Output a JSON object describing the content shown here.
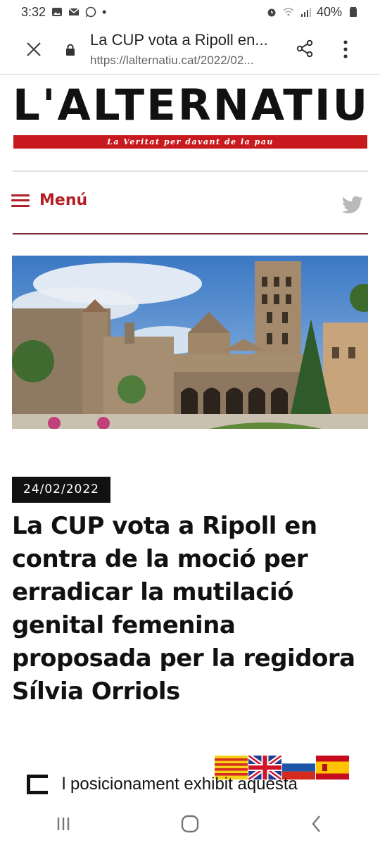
{
  "status": {
    "time": "3:32",
    "battery": "40%",
    "dot": "•"
  },
  "browser": {
    "title": "La CUP vota a Ripoll en...",
    "url": "https://lalternatiu.cat/2022/02..."
  },
  "site": {
    "brand": "L'ALTERNATIU",
    "tagline": "La Veritat per davant de la pau",
    "menu_label": "Menú"
  },
  "article": {
    "date": "24/02/2022",
    "headline": "La CUP vota a Ripoll en contra de la moció per erradicar la mutilació genital femenina proposada per la regidora Sílvia Orriols",
    "snippet": "l posicionament exhibit aquesta"
  },
  "colors": {
    "brand_red": "#c8191e",
    "menu_red": "#b41e24",
    "twitter_grey": "#b9b9b9"
  },
  "icons": {
    "close": "close-icon",
    "lock": "lock-icon",
    "share": "share-icon",
    "more": "more-vert-icon",
    "menu": "hamburger-icon",
    "twitter": "twitter-icon"
  },
  "flags": [
    "catalan-flag",
    "uk-flag",
    "russian-flag",
    "spanish-flag"
  ]
}
